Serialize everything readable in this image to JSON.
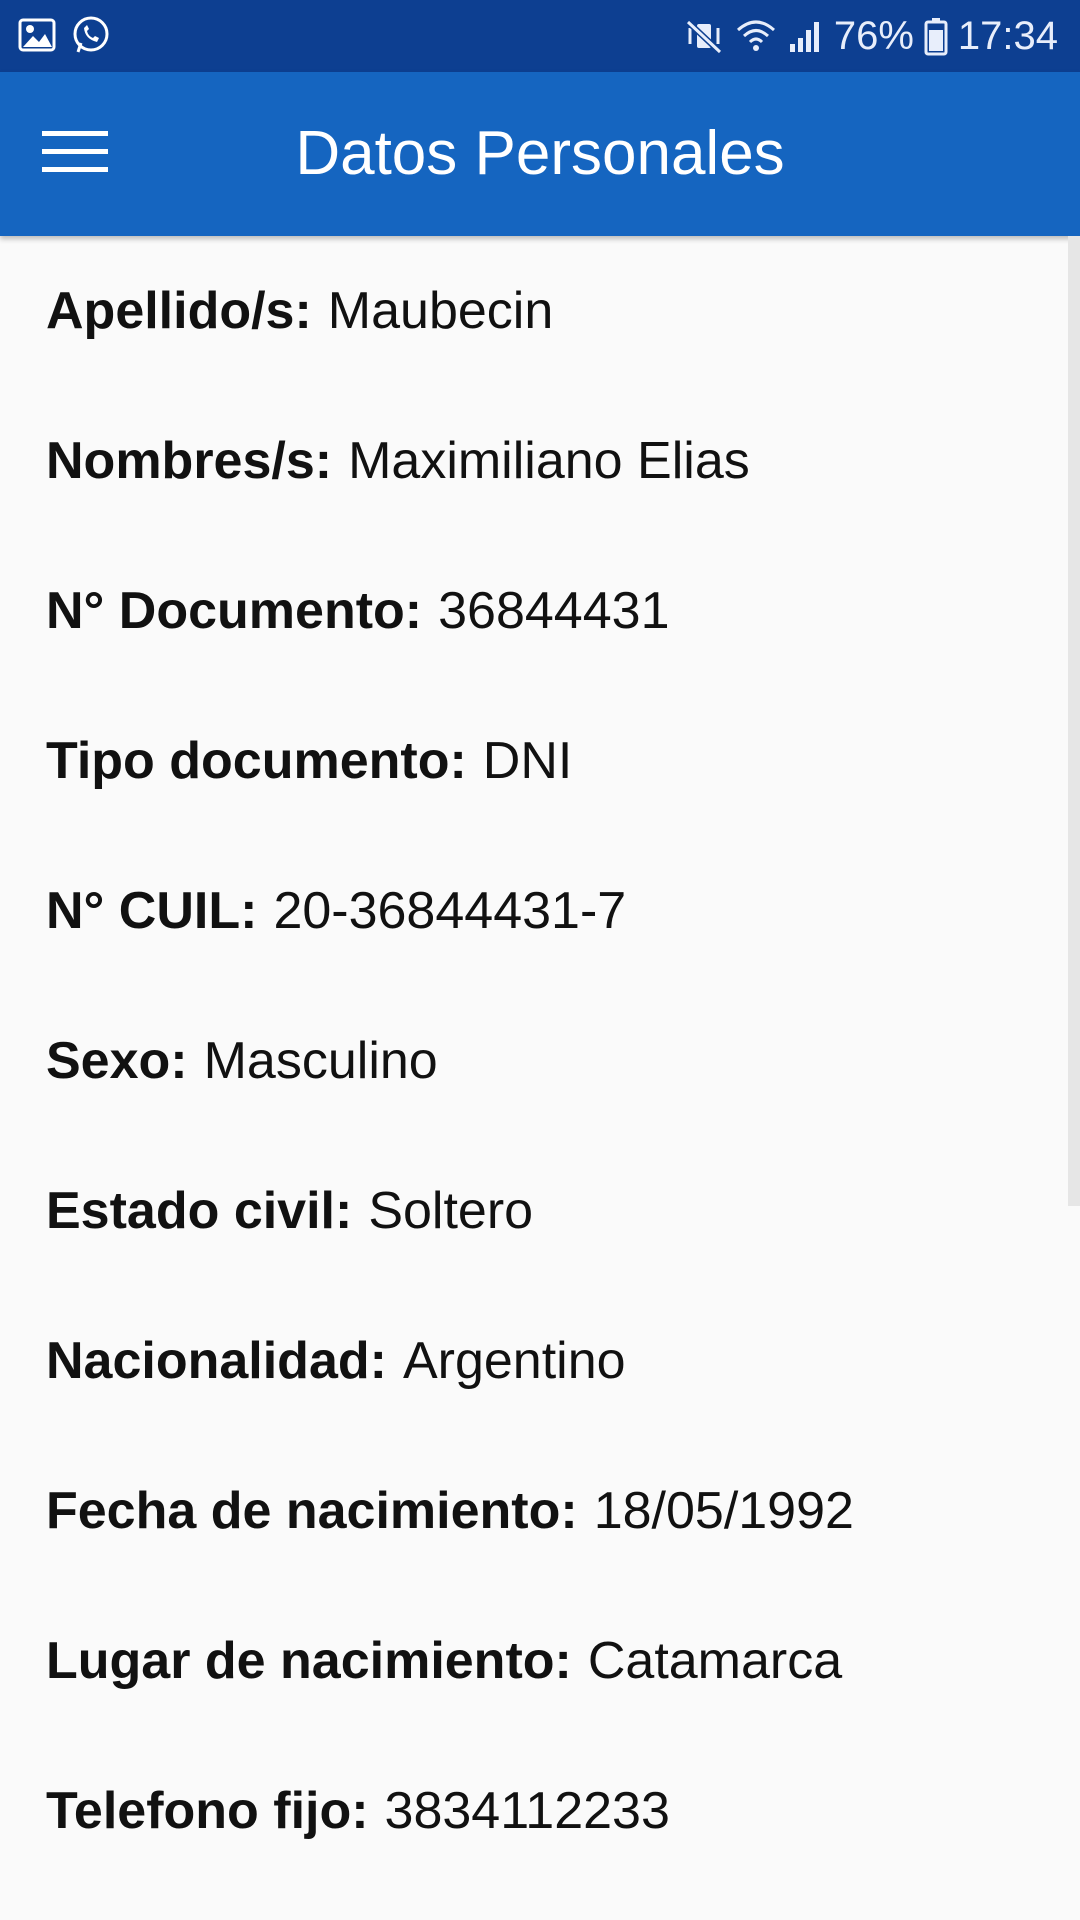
{
  "status_bar": {
    "left_icons": [
      "gallery-icon",
      "whatsapp-icon"
    ],
    "right_icons": [
      "mute-vibrate-icon",
      "wifi-icon",
      "signal-icon",
      "battery-icon"
    ],
    "battery": "76%",
    "time": "17:34"
  },
  "app_bar": {
    "title": "Datos Personales",
    "menu_icon": "hamburger-menu-icon",
    "background_color": "#1565c0"
  },
  "fields": [
    {
      "label": "Apellido/s:",
      "value": "Maubecin"
    },
    {
      "label": "Nombres/s:",
      "value": "Maximiliano Elias"
    },
    {
      "label": "N° Documento:",
      "value": "36844431"
    },
    {
      "label": "Tipo documento:",
      "value": "DNI"
    },
    {
      "label": "N° CUIL:",
      "value": "20-36844431-7"
    },
    {
      "label": "Sexo:",
      "value": "Masculino"
    },
    {
      "label": "Estado civil:",
      "value": "Soltero"
    },
    {
      "label": "Nacionalidad:",
      "value": "Argentino"
    },
    {
      "label": "Fecha de nacimiento:",
      "value": "18/05/1992"
    },
    {
      "label": "Lugar de nacimiento:",
      "value": "Catamarca"
    },
    {
      "label": "Telefono fijo:",
      "value": "3834112233"
    }
  ]
}
